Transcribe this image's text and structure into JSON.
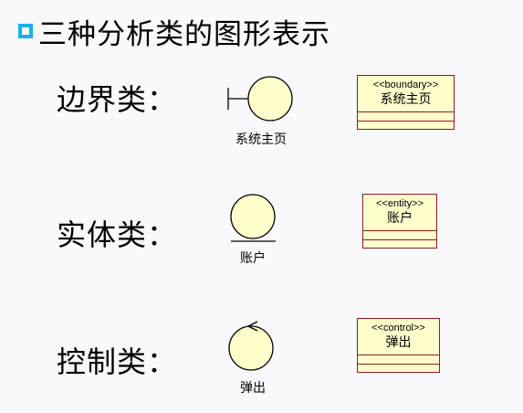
{
  "title": "三种分析类的图形表示",
  "colors": {
    "bullet": "#19b2e8",
    "icon_fill": "#ffffcc",
    "box_border": "#8a1c2a"
  },
  "rows": [
    {
      "label": "边界类：",
      "icon": "boundary-icon",
      "icon_label": "系统主页",
      "stereotype": "<<boundary>>",
      "class_name": "系统主页"
    },
    {
      "label": "实体类：",
      "icon": "entity-icon",
      "icon_label": "账户",
      "stereotype": "<<entity>>",
      "class_name": "账户"
    },
    {
      "label": "控制类：",
      "icon": "control-icon",
      "icon_label": "弹出",
      "stereotype": "<<control>>",
      "class_name": "弹出"
    }
  ]
}
